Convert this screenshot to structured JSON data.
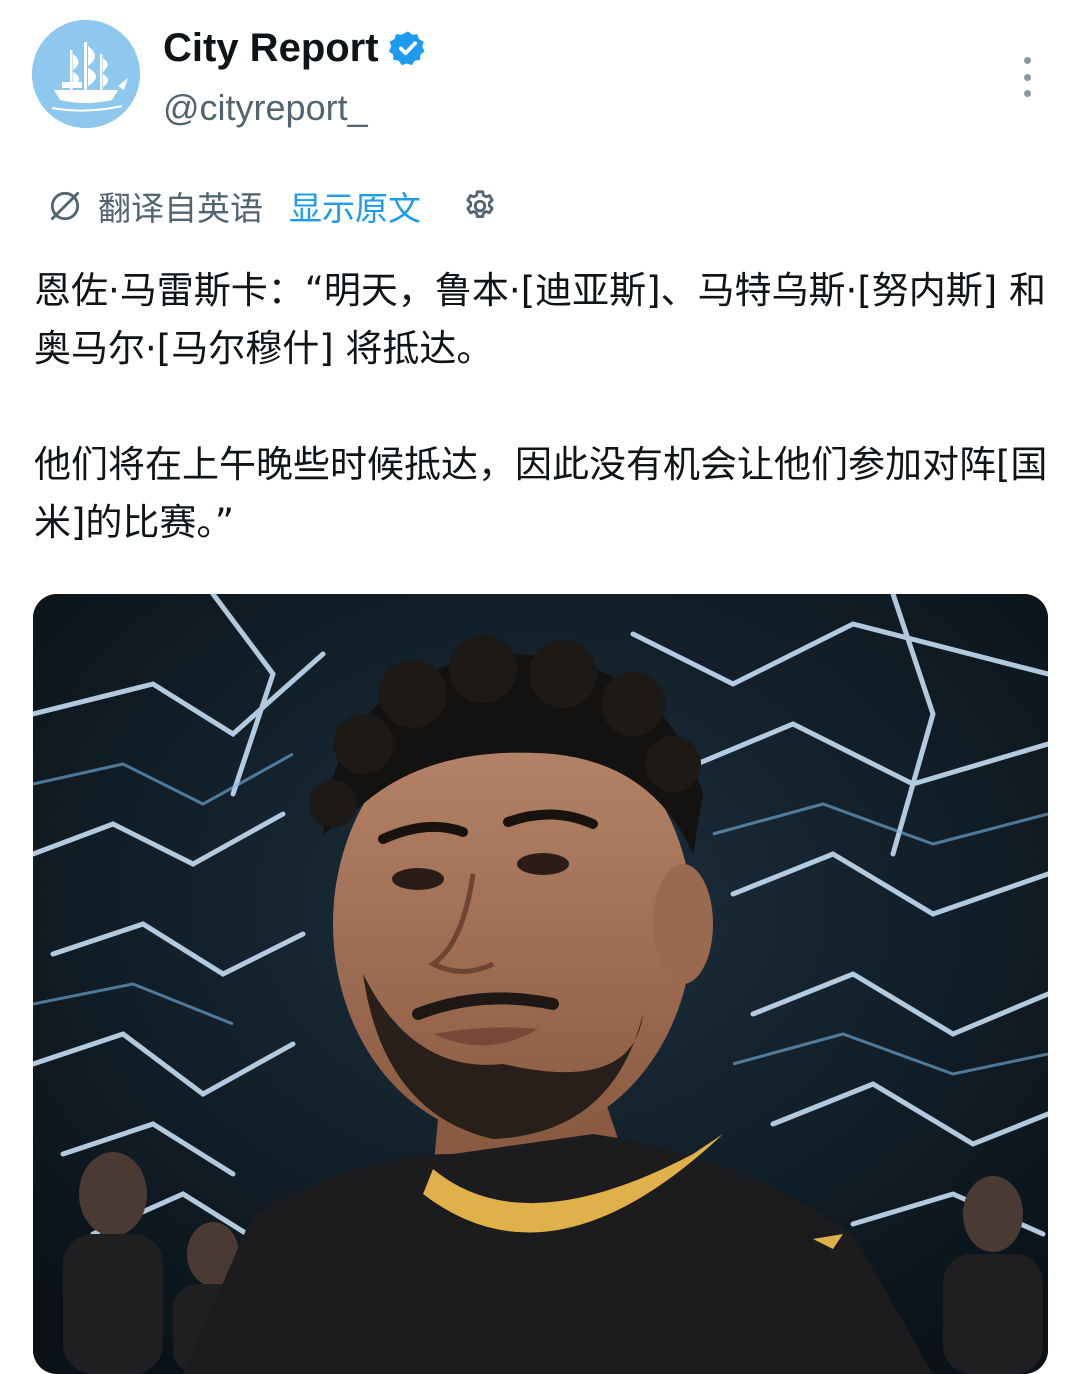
{
  "account": {
    "display_name": "City Report",
    "handle": "@cityreport_",
    "verified": true,
    "avatar_icon": "ship-icon"
  },
  "translation": {
    "label": "翻译自英语",
    "show_original": "显示原文",
    "icon": "globe-off-icon",
    "settings_icon": "gear-icon"
  },
  "tweet": {
    "paragraph1": "恩佐·马雷斯卡：“明天，鲁本·[迪亚斯]、马特乌斯·[努内斯] 和 奥马尔·[马尔穆什] 将抵达。",
    "paragraph2": "他们将在上午晚些时候抵达，因此没有机会让他们参加对阵[国米]的比赛。”"
  },
  "media": {
    "description_icon": "photo-image",
    "alt": "player-photo"
  },
  "colors": {
    "accent": "#1d9bf0",
    "secondary_text": "#536471",
    "primary_text": "#0f1419",
    "avatar_bg": "#8ec8ee"
  }
}
